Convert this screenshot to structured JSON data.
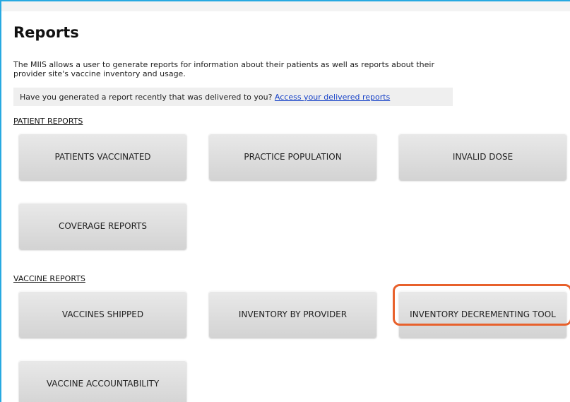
{
  "page": {
    "title": "Reports",
    "intro": "The MIIS allows a user to generate reports for information about their patients as well as reports about their provider site's vaccine inventory and usage.",
    "notice": {
      "text": "Have you generated a report recently that was delivered to you?",
      "link_label": "Access your delivered reports"
    }
  },
  "patient_reports": {
    "heading": "PATIENT REPORTS",
    "buttons": [
      {
        "label": "PATIENTS VACCINATED"
      },
      {
        "label": "PRACTICE POPULATION"
      },
      {
        "label": "INVALID DOSE"
      },
      {
        "label": "COVERAGE REPORTS"
      }
    ]
  },
  "vaccine_reports": {
    "heading": "VACCINE REPORTS",
    "buttons": [
      {
        "label": "VACCINES SHIPPED"
      },
      {
        "label": "INVENTORY BY PROVIDER"
      },
      {
        "label": "INVENTORY DECREMENTING TOOL",
        "highlighted": true
      },
      {
        "label": "VACCINE ACCOUNTABILITY"
      }
    ]
  },
  "colors": {
    "frame_border": "#27a9e1",
    "highlight": "#e8612c",
    "link": "#1a44c8",
    "button_top": "#e9e9e9",
    "button_bottom": "#d3d3d3"
  }
}
